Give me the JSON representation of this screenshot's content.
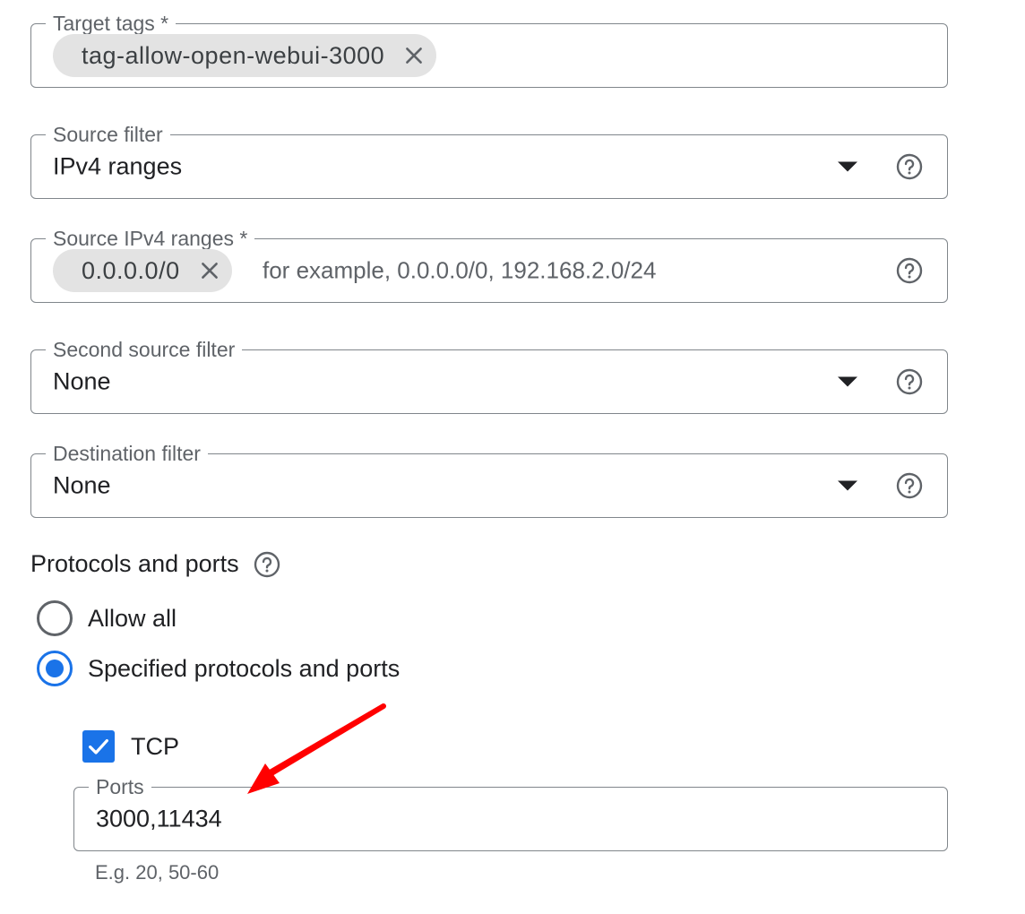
{
  "target_tags": {
    "label": "Target tags *",
    "chips": [
      "tag-allow-open-webui-3000"
    ]
  },
  "source_filter": {
    "label": "Source filter",
    "value": "IPv4 ranges"
  },
  "source_ipv4_ranges": {
    "label": "Source IPv4 ranges *",
    "chips": [
      "0.0.0.0/0"
    ],
    "placeholder": "for example, 0.0.0.0/0, 192.168.2.0/24"
  },
  "second_source_filter": {
    "label": "Second source filter",
    "value": "None"
  },
  "destination_filter": {
    "label": "Destination filter",
    "value": "None"
  },
  "protocols_and_ports": {
    "title": "Protocols and ports",
    "options": [
      {
        "label": "Allow all",
        "selected": false
      },
      {
        "label": "Specified protocols and ports",
        "selected": true
      }
    ],
    "tcp": {
      "label": "TCP",
      "checked": true,
      "ports_label": "Ports",
      "ports_value": "3000,11434",
      "helper": "E.g. 20, 50-60"
    }
  },
  "colors": {
    "accent": "#1a73e8",
    "annotation_arrow": "#ff0000",
    "border": "#80868b",
    "chip_bg": "#e3e3e3"
  },
  "icons": {
    "chip_remove": "close-icon",
    "dropdown": "dropdown-arrow-icon",
    "help": "help-circle-icon",
    "checkmark": "check-icon"
  }
}
